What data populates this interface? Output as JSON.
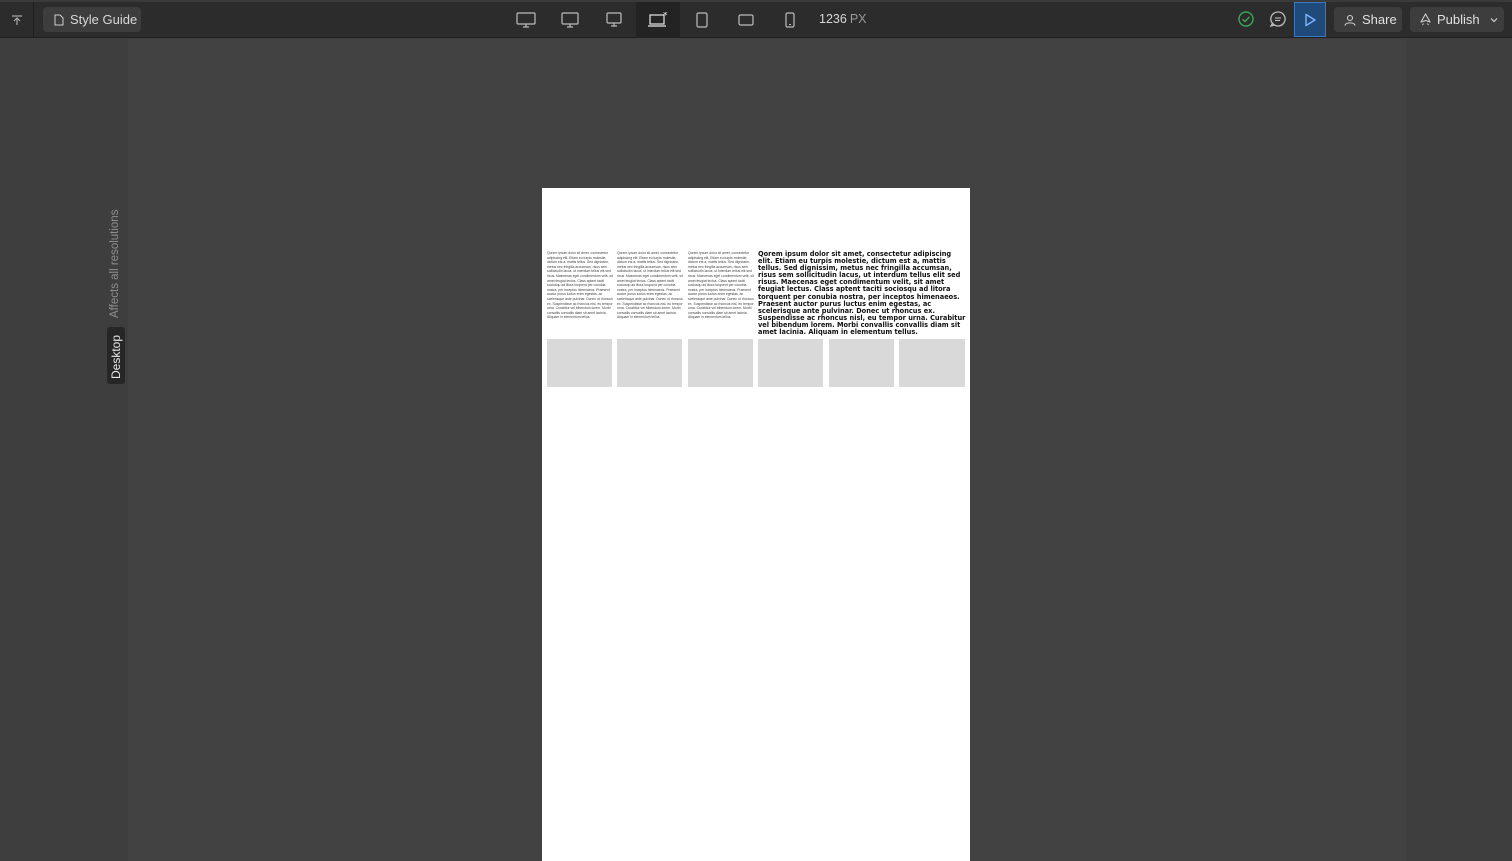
{
  "toolbar": {
    "page_name": "Style Guide",
    "breakpoints": [
      {
        "name": "desktop-large",
        "icon": "monitor-icon",
        "active": false
      },
      {
        "name": "desktop-medium",
        "icon": "monitor-icon",
        "active": false
      },
      {
        "name": "desktop",
        "icon": "monitor-icon",
        "active": false
      },
      {
        "name": "desktop-base",
        "icon": "laptop-star-icon",
        "active": true
      },
      {
        "name": "tablet",
        "icon": "tablet-icon",
        "active": false
      },
      {
        "name": "tablet-landscape",
        "icon": "tablet-landscape-icon",
        "active": false
      },
      {
        "name": "mobile",
        "icon": "phone-icon",
        "active": false
      }
    ],
    "width_value": "1236",
    "width_unit": "PX",
    "share_label": "Share",
    "publish_label": "Publish"
  },
  "canvas": {
    "affects_label": "Affects all resolutions",
    "breakpoint_tab": "Desktop",
    "columns": [
      "Qorem ipsum dolor sit amet, consectetur adipiscing elit. Etiam eu turpis molestie, dictum est a, mattis tellus. Sed dignissim, metus nec fringilla accumsan, risus sem sollicitudin lacus, ut interdum tellus elit sed risus. Maecenas eget condimentum velit, sit amet feugiat lectus. Class aptent taciti sociosqu ad litora torquent per conubia nostra, per inceptos himenaeos. Praesent auctor purus luctus enim egestas, ac scelerisque ante pulvinar. Donec ut rhoncus ex. Suspendisse ac rhoncus nisl, eu tempor urna. Curabitur vel bibendum lorem. Morbi convallis convallis diam sit amet lacinia. Aliquam in elementum tellus.",
      "Qorem ipsum dolor sit amet, consectetur adipiscing elit. Etiam eu turpis molestie, dictum est a, mattis tellus. Sed dignissim, metus nec fringilla accumsan, risus sem sollicitudin lacus, ut interdum tellus elit sed risus. Maecenas eget condimentum velit, sit amet feugiat lectus. Class aptent taciti sociosqu ad litora torquent per conubia nostra, per inceptos himenaeos. Praesent auctor purus luctus enim egestas, ac scelerisque ante pulvinar. Donec ut rhoncus ex. Suspendisse ac rhoncus nisl, eu tempor urna. Curabitur vel bibendum lorem. Morbi convallis convallis diam sit amet lacinia. Aliquam in elementum tellus.",
      "Qorem ipsum dolor sit amet, consectetur adipiscing elit. Etiam eu turpis molestie, dictum est a, mattis tellus. Sed dignissim, metus nec fringilla accumsan, risus sem sollicitudin lacus, ut interdum tellus elit sed risus. Maecenas eget condimentum velit, sit amet feugiat lectus. Class aptent taciti sociosqu ad litora torquent per conubia nostra, per inceptos himenaeos. Praesent auctor purus luctus enim egestas, ac scelerisque ante pulvinar. Donec ut rhoncus ex. Suspendisse ac rhoncus nisl, eu tempor urna. Curabitur vel bibendum lorem. Morbi convallis convallis diam sit amet lacinia. Aliquam in elementum tellus."
    ],
    "feature_text": "Qorem ipsum dolor sit amet, consectetur adipiscing elit. Etiam eu turpis molestie, dictum est a, mattis tellus. Sed dignissim, metus nec fringilla accumsan, risus sem sollicitudin lacus, ut interdum tellus elit sed risus. Maecenas eget condimentum velit, sit amet feugiat lectus. Class aptent taciti sociosqu ad litora torquent per conubia nostra, per inceptos himenaeos. Praesent auctor purus luctus enim egestas, ac scelerisque ante pulvinar. Donec ut rhoncus ex. Suspendisse ac rhoncus nisl, eu tempor urna. Curabitur vel bibendum lorem. Morbi convallis convallis diam sit amet lacinia. Aliquam in elementum tellus.",
    "image_placeholders": 6
  },
  "colors": {
    "preview_active": "#1f4a7a",
    "status_ok": "#3aa655",
    "placeholder": "#d9d9d9"
  }
}
